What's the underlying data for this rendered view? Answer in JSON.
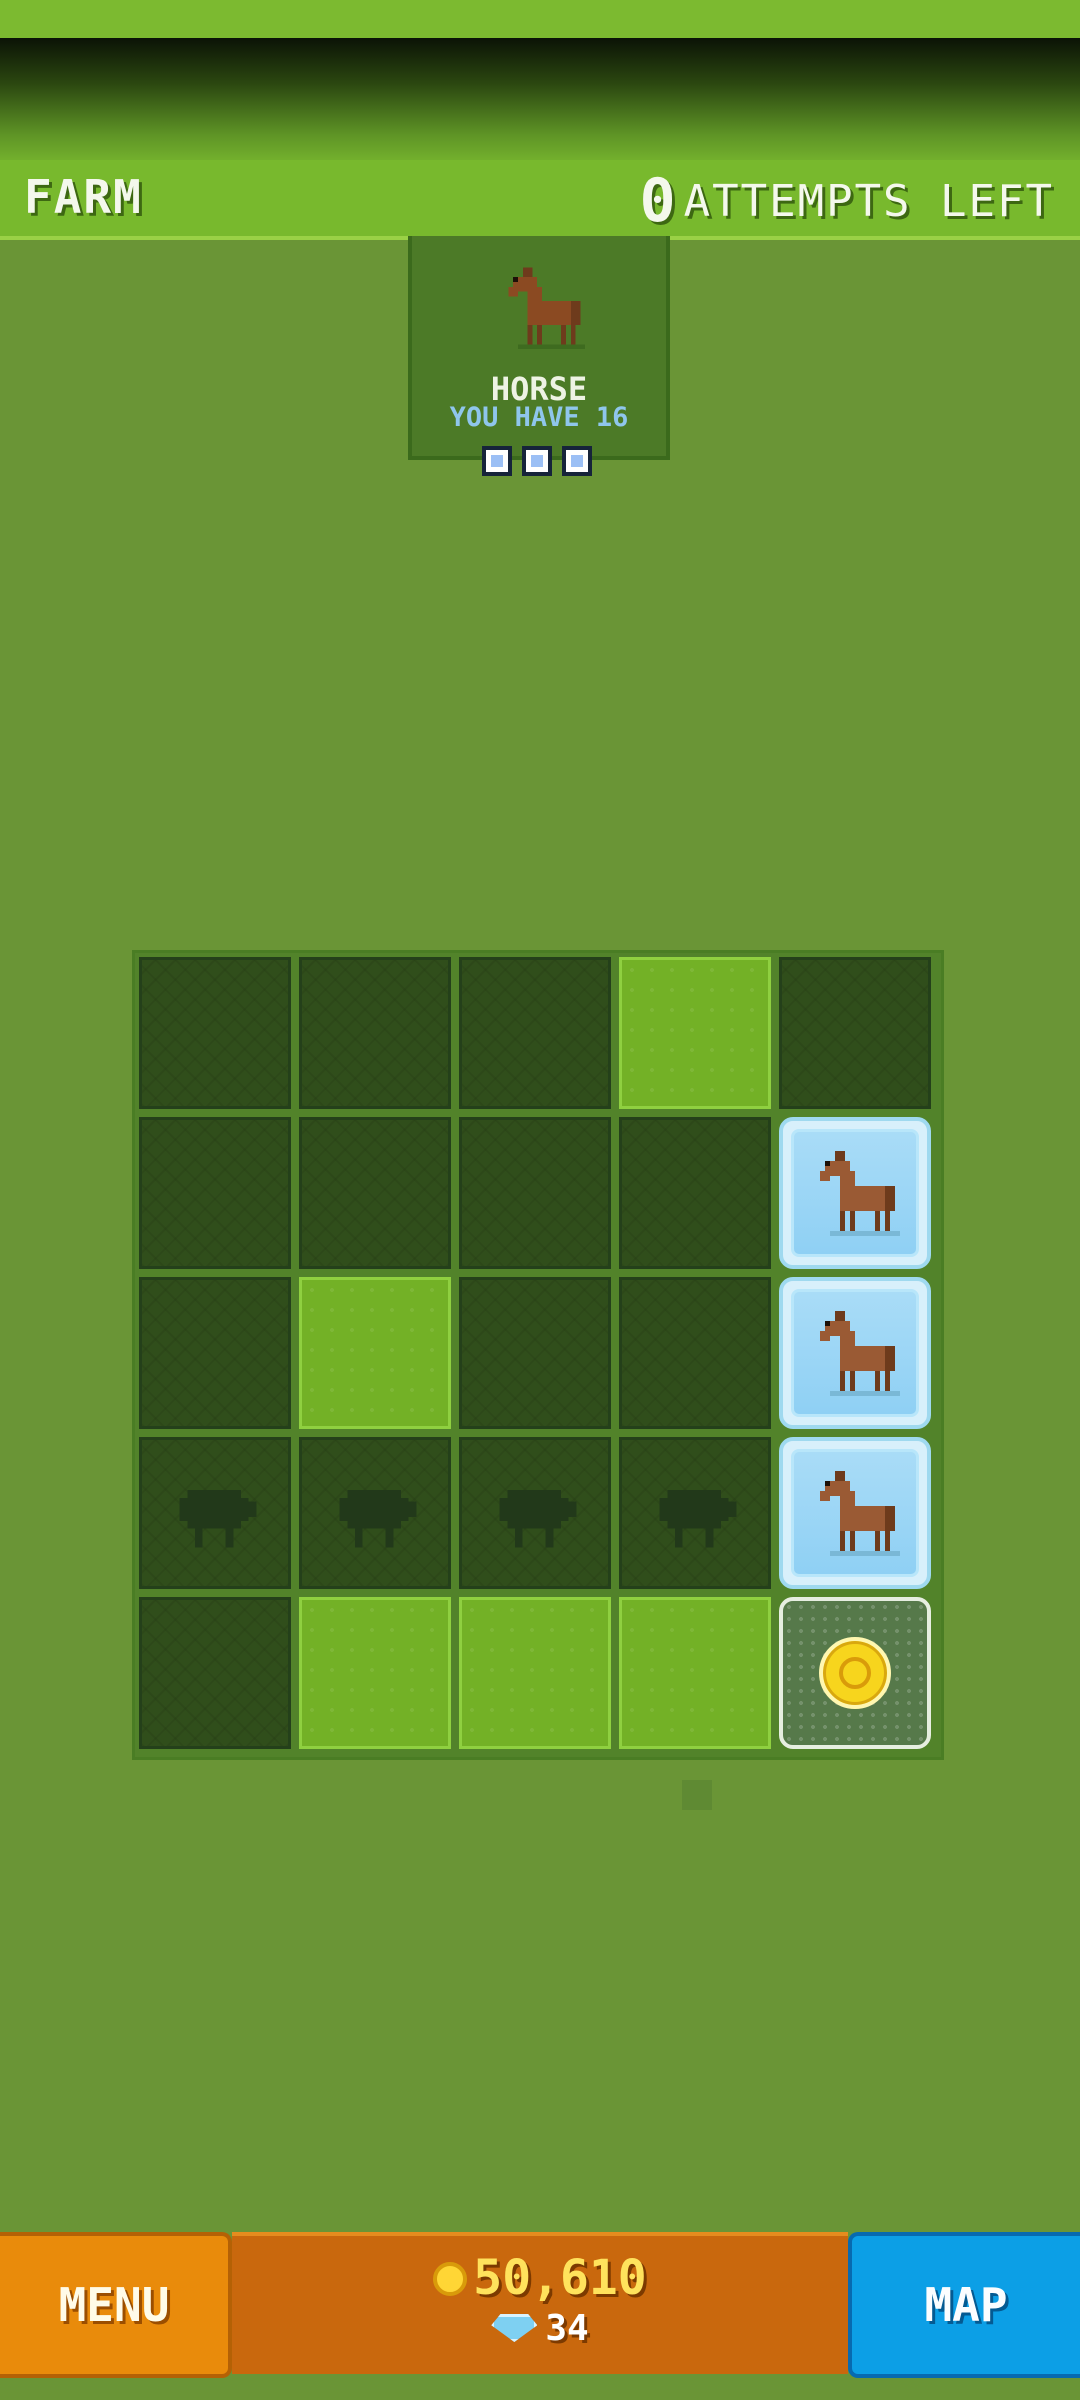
{
  "header": {
    "title": "FARM",
    "attempts_count": "0",
    "attempts_label": "ATTEMPTS LEFT"
  },
  "target": {
    "animal_name": "HORSE",
    "you_have": "YOU HAVE 16",
    "icon": "horse-icon",
    "progress_dots": 3
  },
  "board": {
    "rows": 5,
    "cols": 5,
    "cells": [
      [
        "dark",
        "dark",
        "dark",
        "grass",
        "dark"
      ],
      [
        "dark",
        "dark",
        "dark",
        "dark",
        "ice-horse"
      ],
      [
        "dark",
        "grass",
        "dark",
        "dark",
        "ice-horse"
      ],
      [
        "sheep",
        "sheep",
        "sheep",
        "sheep",
        "ice-horse"
      ],
      [
        "dark",
        "grass",
        "grass",
        "grass",
        "coin"
      ]
    ]
  },
  "bottom": {
    "menu_label": "MENU",
    "coins": "50,610",
    "gems": "34",
    "map_label": "MAP"
  },
  "colors": {
    "background": "#6a9536",
    "menu_button": "#e98b0b",
    "map_button": "#0c9fe6",
    "coin_text": "#ffe25c"
  }
}
